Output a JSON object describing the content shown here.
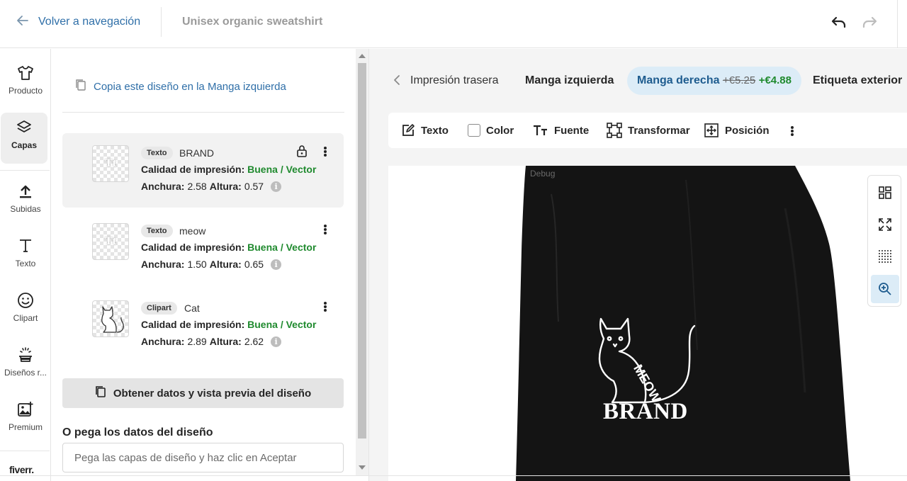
{
  "topbar": {
    "back_label": "Volver a navegación",
    "product_title": "Unisex organic sweatshirt"
  },
  "sidebar": {
    "items": [
      {
        "label": "Producto",
        "icon": "tshirt-icon"
      },
      {
        "label": "Capas",
        "icon": "layers-icon",
        "active": true
      },
      {
        "label": "Subidas",
        "icon": "upload-icon"
      },
      {
        "label": "Texto",
        "icon": "text-icon"
      },
      {
        "label": "Clipart",
        "icon": "smiley-icon"
      },
      {
        "label": "Diseños r...",
        "icon": "magic-wand-icon"
      },
      {
        "label": "Premium",
        "icon": "image-plus-icon"
      }
    ],
    "logo": "fiverr."
  },
  "panel": {
    "copy_link": "Copia este diseño en la Manga izquierda",
    "layers": [
      {
        "tag": "Texto",
        "name": "BRAND",
        "quality_label": "Calidad de impresión:",
        "quality_value": "Buena / Vector",
        "width_label": "Anchura:",
        "width": "2.58",
        "height_label": "Altura:",
        "height": "0.57",
        "locked": true,
        "selected": true
      },
      {
        "tag": "Texto",
        "name": "meow",
        "quality_label": "Calidad de impresión:",
        "quality_value": "Buena / Vector",
        "width_label": "Anchura:",
        "width": "1.50",
        "height_label": "Altura:",
        "height": "0.65"
      },
      {
        "tag": "Clipart",
        "name": "Cat",
        "quality_label": "Calidad de impresión:",
        "quality_value": "Buena / Vector",
        "width_label": "Anchura:",
        "width": "2.89",
        "height_label": "Altura:",
        "height": "2.62"
      }
    ],
    "get_data_button": "Obtener datos y vista previa del diseño",
    "paste_heading": "O pega los datos del diseño",
    "paste_placeholder": "Pega las capas de diseño y haz clic en Aceptar"
  },
  "area_tabs": [
    {
      "label": "Impresión trasera"
    },
    {
      "label": "Manga izquierda"
    },
    {
      "label": "Manga derecha",
      "old_price": "+€5.25",
      "new_price": "+€4.88",
      "active": true
    },
    {
      "label": "Etiqueta exterior"
    }
  ],
  "toolbar": {
    "text": "Texto",
    "color": "Color",
    "font": "Fuente",
    "transform": "Transformar",
    "position": "Posición"
  },
  "canvas": {
    "debug": "Debug",
    "design_brand": "BRAND",
    "design_meow": "MEOW",
    "garment_color": "#141414"
  },
  "view_tools": [
    "grid-view-icon",
    "expand-icon",
    "dotted-grid-icon",
    "zoom-in-icon"
  ],
  "colors": {
    "accent": "#2f6fa8",
    "good": "#1f8a2e",
    "active_tab_bg": "#dcecf7"
  }
}
